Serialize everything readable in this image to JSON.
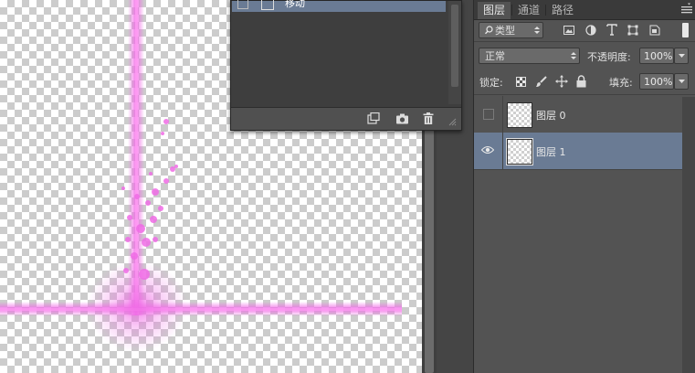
{
  "floating_panel": {
    "selected_item": "移动",
    "buttons": [
      {
        "icon": "new-snapshot-icon"
      },
      {
        "icon": "camera-icon"
      },
      {
        "icon": "trash-icon"
      }
    ]
  },
  "layers_panel": {
    "tabs": [
      "图层",
      "通道",
      "路径"
    ],
    "active_tab": "图层",
    "filter": {
      "label": "类型",
      "icons": [
        "image-filter-icon",
        "adjustment-filter-icon",
        "text-filter-icon",
        "shape-filter-icon",
        "smart-object-filter-icon"
      ]
    },
    "blend_mode": "正常",
    "opacity_label": "不透明度:",
    "opacity_value": "100%",
    "lock_label": "锁定:",
    "lock_icons": [
      "lock-transparent-icon",
      "lock-brush-icon",
      "lock-move-icon",
      "lock-all-icon"
    ],
    "fill_label": "填充:",
    "fill_value": "100%",
    "layers": [
      {
        "name": "图层 0",
        "visible": false,
        "selected": false
      },
      {
        "name": "图层 1",
        "visible": true,
        "selected": true
      }
    ]
  },
  "colors": {
    "glow": "#f06ce6",
    "selection": "#6a7b94",
    "panel_bg": "#535353"
  }
}
